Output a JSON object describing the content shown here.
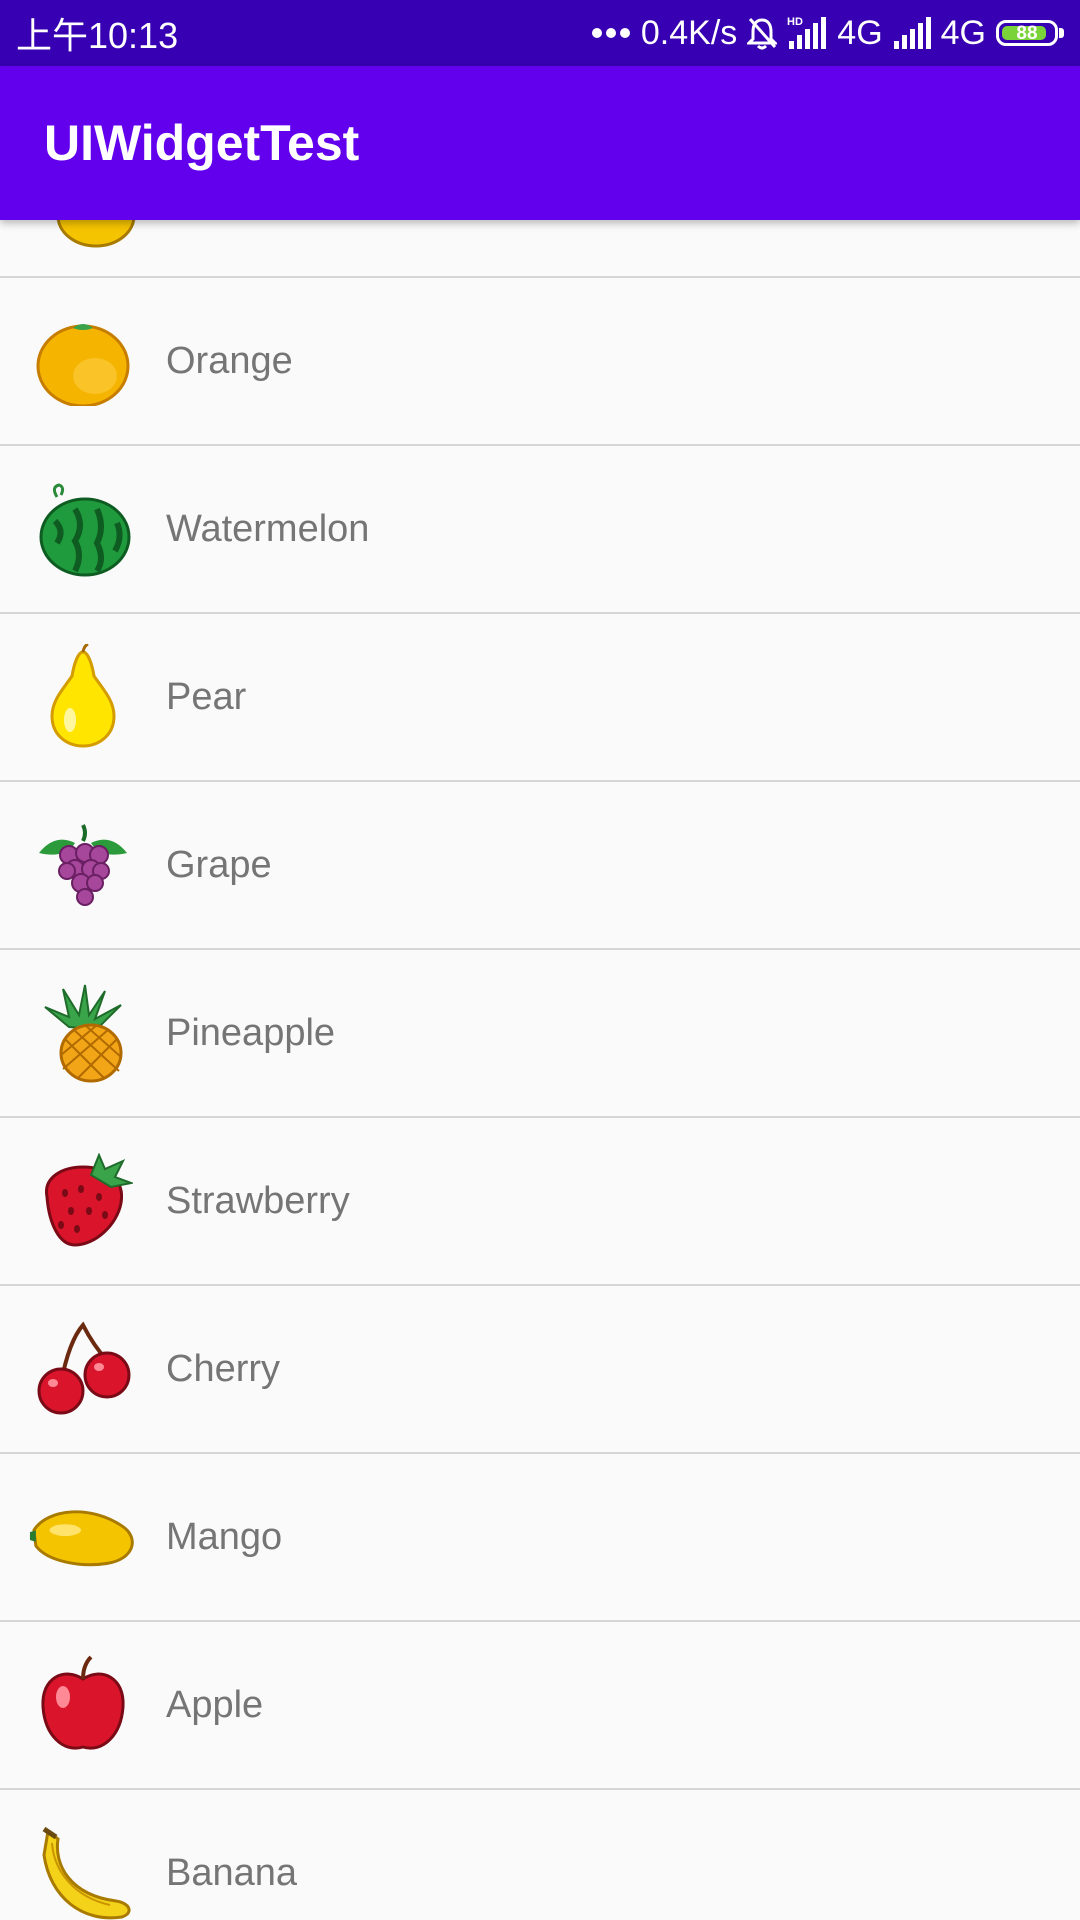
{
  "status_bar": {
    "time": "上午10:13",
    "speed": "0.4K/s",
    "network_1": "4G",
    "network_2": "4G",
    "battery_level": "88",
    "hd_label": "HD"
  },
  "app_bar": {
    "title": "UIWidgetTest"
  },
  "fruits": [
    {
      "name": "Orange",
      "icon": "orange-icon"
    },
    {
      "name": "Watermelon",
      "icon": "watermelon-icon"
    },
    {
      "name": "Pear",
      "icon": "pear-icon"
    },
    {
      "name": "Grape",
      "icon": "grape-icon"
    },
    {
      "name": "Pineapple",
      "icon": "pineapple-icon"
    },
    {
      "name": "Strawberry",
      "icon": "strawberry-icon"
    },
    {
      "name": "Cherry",
      "icon": "cherry-icon"
    },
    {
      "name": "Mango",
      "icon": "mango-icon"
    },
    {
      "name": "Apple",
      "icon": "apple-icon"
    },
    {
      "name": "Banana",
      "icon": "banana-icon"
    }
  ],
  "colors": {
    "status_bar": "#3700b3",
    "app_bar": "#6200ee",
    "list_background": "#fafafa",
    "label_text": "#757575",
    "divider": "#d6d6d6"
  }
}
